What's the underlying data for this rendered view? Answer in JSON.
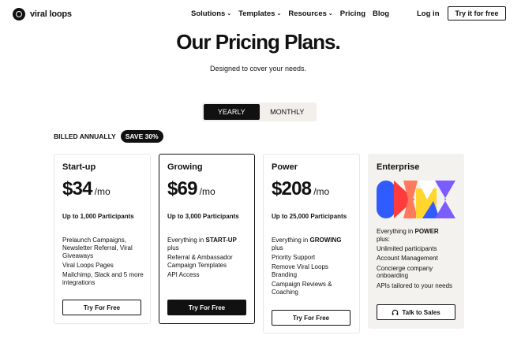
{
  "nav": {
    "brand": "viral loops",
    "menu": [
      {
        "label": "Solutions",
        "has_dropdown": true
      },
      {
        "label": "Templates",
        "has_dropdown": true
      },
      {
        "label": "Resources",
        "has_dropdown": true
      },
      {
        "label": "Pricing",
        "has_dropdown": false
      },
      {
        "label": "Blog",
        "has_dropdown": false
      }
    ],
    "login": "Log in",
    "cta": "Try it for free"
  },
  "hero": {
    "title": "Our Pricing Plans.",
    "subtitle": "Designed to cover your needs."
  },
  "billing_toggle": {
    "options": [
      "YEARLY",
      "MONTHLY"
    ],
    "selected": "YEARLY"
  },
  "billed": {
    "label": "BILLED ANNUALLY",
    "badge": "SAVE 30%"
  },
  "plans": [
    {
      "name": "Start-up",
      "price": "$34",
      "period": "/mo",
      "participants": "Up to 1,000 Participants",
      "features": [
        "Prelaunch Campaigns, Newsletter Referral, Viral Giveaways",
        "Viral Loops Pages",
        "Mailchimp, Slack and 5 more integrations"
      ],
      "button": "Try For Free"
    },
    {
      "name": "Growing",
      "price": "$69",
      "period": "/mo",
      "participants": "Up to 3,000 Participants",
      "everything_prefix": "Everything in",
      "everything_tier": "START-UP",
      "everything_suffix": "plus",
      "features": [
        "Referral & Ambassador Campaign Templates",
        "API Access"
      ],
      "button": "Try For Free"
    },
    {
      "name": "Power",
      "price": "$208",
      "period": "/mo",
      "participants": "Up to 25,000 Participants",
      "everything_prefix": "Everything in",
      "everything_tier": "GROWING",
      "everything_suffix": "plus",
      "features": [
        "Priority Support",
        "Remove Viral Loops Branding",
        "Campaign Reviews & Coaching"
      ],
      "button": "Try For Free"
    },
    {
      "name": "Enterprise",
      "everything_prefix": "Everything in",
      "everything_tier": "POWER",
      "everything_suffix": "plus:",
      "features": [
        "Unlimited participants",
        "Account Management",
        "Concierge company onboarding",
        "APIs tailored to your needs"
      ],
      "button": "Talk to Sales",
      "button_icon": "headset-icon"
    }
  ],
  "colors": {
    "text": "#111111",
    "toggle_bg": "#f3f0ec",
    "enterprise_bg": "#f4f2ef",
    "art_blue": "#2f5bff",
    "art_red": "#ff3b3b",
    "art_yellow": "#ffd52e",
    "art_purple": "#7b5cff"
  }
}
